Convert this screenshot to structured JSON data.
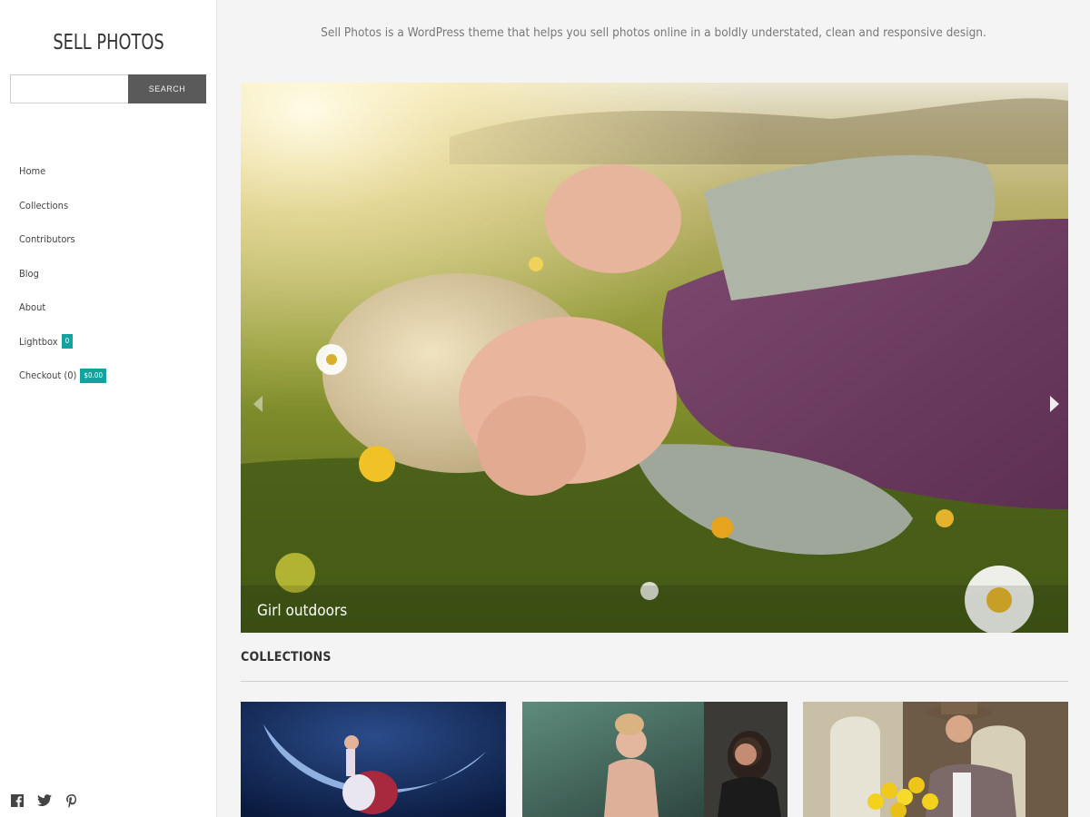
{
  "site": {
    "title": "SELL PHOTOS",
    "tagline": "Sell Photos is a WordPress theme that helps you sell photos online in a boldly understated, clean and responsive design."
  },
  "search": {
    "placeholder": "",
    "value": "",
    "button_label": "SEARCH"
  },
  "nav": {
    "home": "Home",
    "collections": "Collections",
    "contributors": "Contributors",
    "blog": "Blog",
    "about": "About",
    "lightbox": "Lightbox",
    "lightbox_count": "0",
    "checkout": "Checkout (0)",
    "checkout_total": "$0.00"
  },
  "social": {
    "icons": [
      "facebook-icon",
      "twitter-icon",
      "pinterest-icon"
    ]
  },
  "slider": {
    "caption": "Girl outdoors"
  },
  "collections": {
    "heading": "COLLECTIONS"
  },
  "colors": {
    "accent": "#12a39e",
    "sidebar_bg": "#ffffff",
    "page_bg": "#f4f4f4",
    "button_bg": "#5a5a5a"
  }
}
